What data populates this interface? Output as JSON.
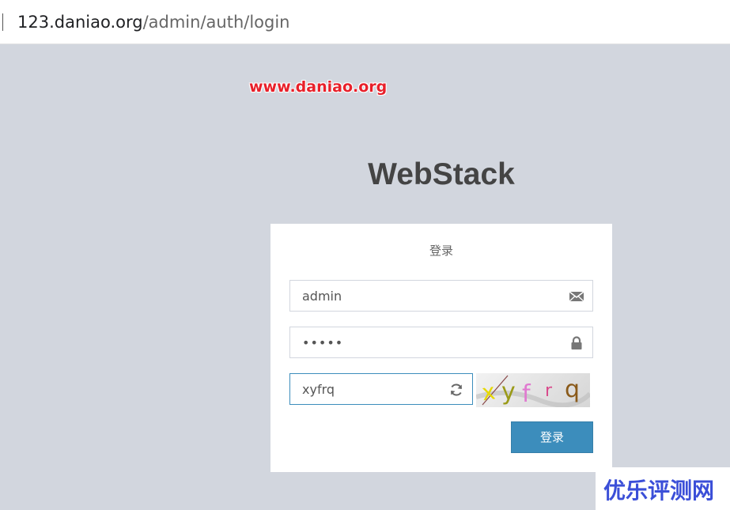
{
  "browser": {
    "url_host": "123.daniao.org",
    "url_path": "/admin/auth/login"
  },
  "watermark": {
    "top_text": "www.daniao.org",
    "bottom_text": "优乐评测网"
  },
  "brand": {
    "title": "WebStack"
  },
  "login": {
    "title": "登录",
    "username_value": "admin",
    "password_value": "•••••",
    "captcha_value": "xyfrq",
    "captcha_image_text": [
      "x",
      "y",
      "f",
      "r",
      "q"
    ],
    "submit_label": "登录"
  },
  "colors": {
    "page_background": "#d2d6de",
    "primary_button": "#3c8dbc",
    "watermark_red": "#e8202a",
    "watermark_blue": "#3b4fd8"
  },
  "icons": {
    "username": "envelope-icon",
    "password": "lock-icon",
    "captcha": "refresh-icon"
  }
}
